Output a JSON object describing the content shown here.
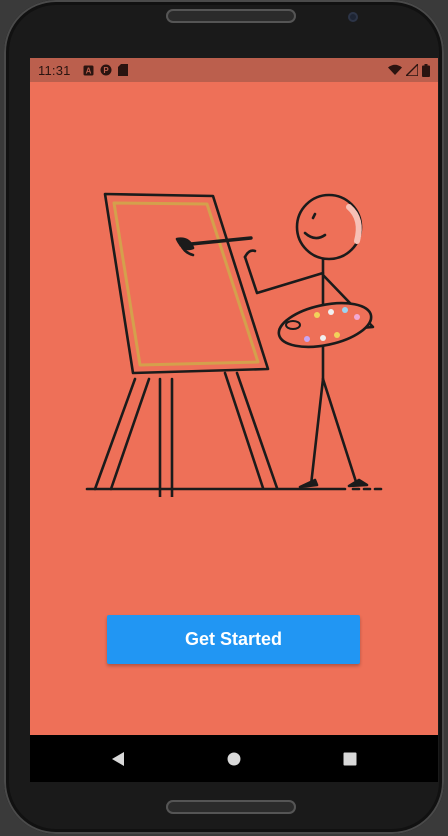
{
  "status_bar": {
    "time": "11:31",
    "left_icons": [
      "notification-a-icon",
      "notification-p-icon",
      "sd-card-icon"
    ],
    "right_icons": [
      "wifi-icon",
      "signal-icon",
      "battery-icon"
    ]
  },
  "main": {
    "illustration_icon": "stick-figure-painter-at-easel-icon",
    "cta_label": "Get Started",
    "cta_color": "#2196f3",
    "background_color": "#ee7058"
  },
  "navigation": {
    "buttons": [
      "back-icon",
      "home-icon",
      "recents-icon"
    ]
  }
}
